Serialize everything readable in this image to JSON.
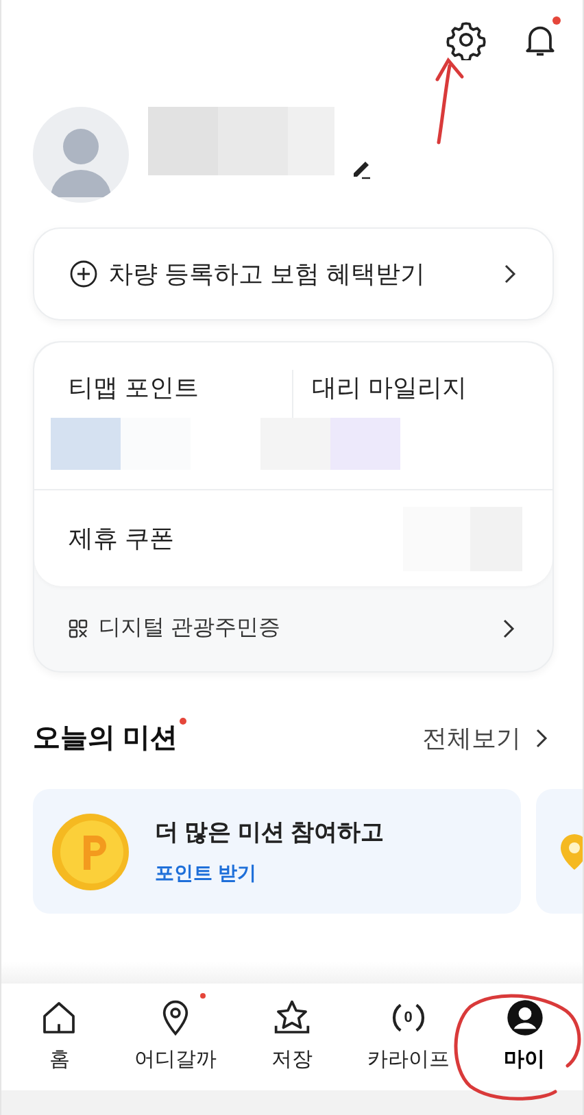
{
  "header": {
    "has_notification": true
  },
  "vehicle_banner": {
    "label": "차량 등록하고 보험 혜택받기"
  },
  "points": [
    {
      "label": "티맵 포인트"
    },
    {
      "label": "대리 마일리지"
    }
  ],
  "coupon": {
    "label": "제휴 쿠폰"
  },
  "digital_id": {
    "label": "디지털 관광주민증"
  },
  "missions": {
    "title": "오늘의 미션",
    "has_new": true,
    "view_all": "전체보기",
    "cards": [
      {
        "title": "더 많은 미션 참여하고",
        "link": "포인트 받기"
      }
    ]
  },
  "tab_bar": [
    {
      "label": "홈",
      "selected": false,
      "dot": false
    },
    {
      "label": "어디갈까",
      "selected": false,
      "dot": true
    },
    {
      "label": "저장",
      "selected": false,
      "dot": false
    },
    {
      "label": "카라이프",
      "selected": false,
      "dot": false,
      "icon_text": "0"
    },
    {
      "label": "마이",
      "selected": true,
      "dot": false
    }
  ]
}
